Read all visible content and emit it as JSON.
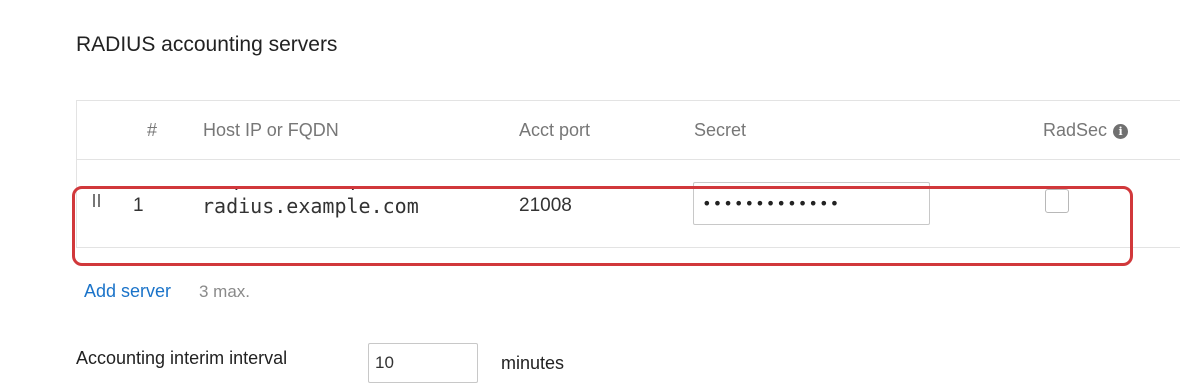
{
  "section": {
    "title": "RADIUS accounting servers"
  },
  "table": {
    "headers": {
      "number": "#",
      "host": "Host IP or FQDN",
      "port": "Acct port",
      "secret": "Secret",
      "radsec": "RadSec"
    },
    "rows": [
      {
        "number": "1",
        "host": "radius.example.com",
        "port": "21008",
        "secret": "•••••••••••••",
        "radsec_checked": false
      }
    ]
  },
  "add_server": {
    "label": "Add server",
    "note": "3 max."
  },
  "interim": {
    "label": "Accounting interim interval",
    "value": "10",
    "unit": "minutes"
  },
  "icons": {
    "radsec_info": "info-icon",
    "row_drag": "drag-handle-icon"
  },
  "colors": {
    "highlight": "#d1383b",
    "link": "#1a73c9"
  }
}
